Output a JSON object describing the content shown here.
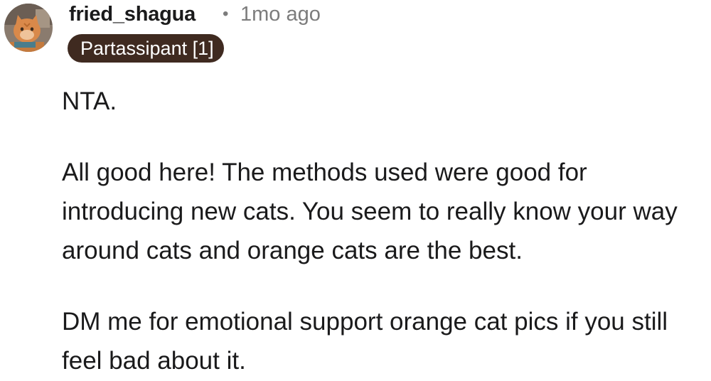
{
  "comment": {
    "author": "fried_shagua",
    "separator": "•",
    "timestamp": "1mo ago",
    "flair": "Partassipant [1]",
    "paragraphs": [
      "NTA.",
      "All good here! The methods used were good for introducing new cats. You seem to really know your way around cats and orange cats are the best.",
      "DM me for emotional support orange cat pics if you still feel bad about it."
    ],
    "avatar_icon": "orange-cat-avatar-icon"
  },
  "colors": {
    "flair_bg": "#3f2a20",
    "flair_text": "#ffffff",
    "meta_text": "#7c7c7c",
    "body_text": "#1a1a1b"
  }
}
